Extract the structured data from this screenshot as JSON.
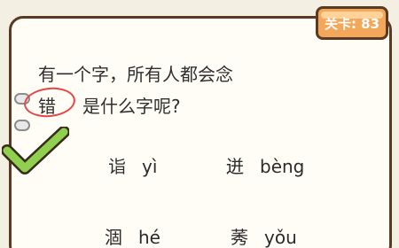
{
  "level": {
    "label": "关卡: 83"
  },
  "question": {
    "line1": "有一个字，所有人都会念",
    "answer_char": "错",
    "line2": "是什么字呢?"
  },
  "options": [
    {
      "char": "诣",
      "pinyin": "yì"
    },
    {
      "char": "迸",
      "pinyin": "bèng"
    },
    {
      "char": "涸",
      "pinyin": "hé"
    },
    {
      "char": "莠",
      "pinyin": "yǒu"
    }
  ],
  "colors": {
    "border": "#5a3a22",
    "badge": "#f3a75a",
    "check": "#8fd14f",
    "circle": "#e34747",
    "paper": "#fffdf6"
  }
}
